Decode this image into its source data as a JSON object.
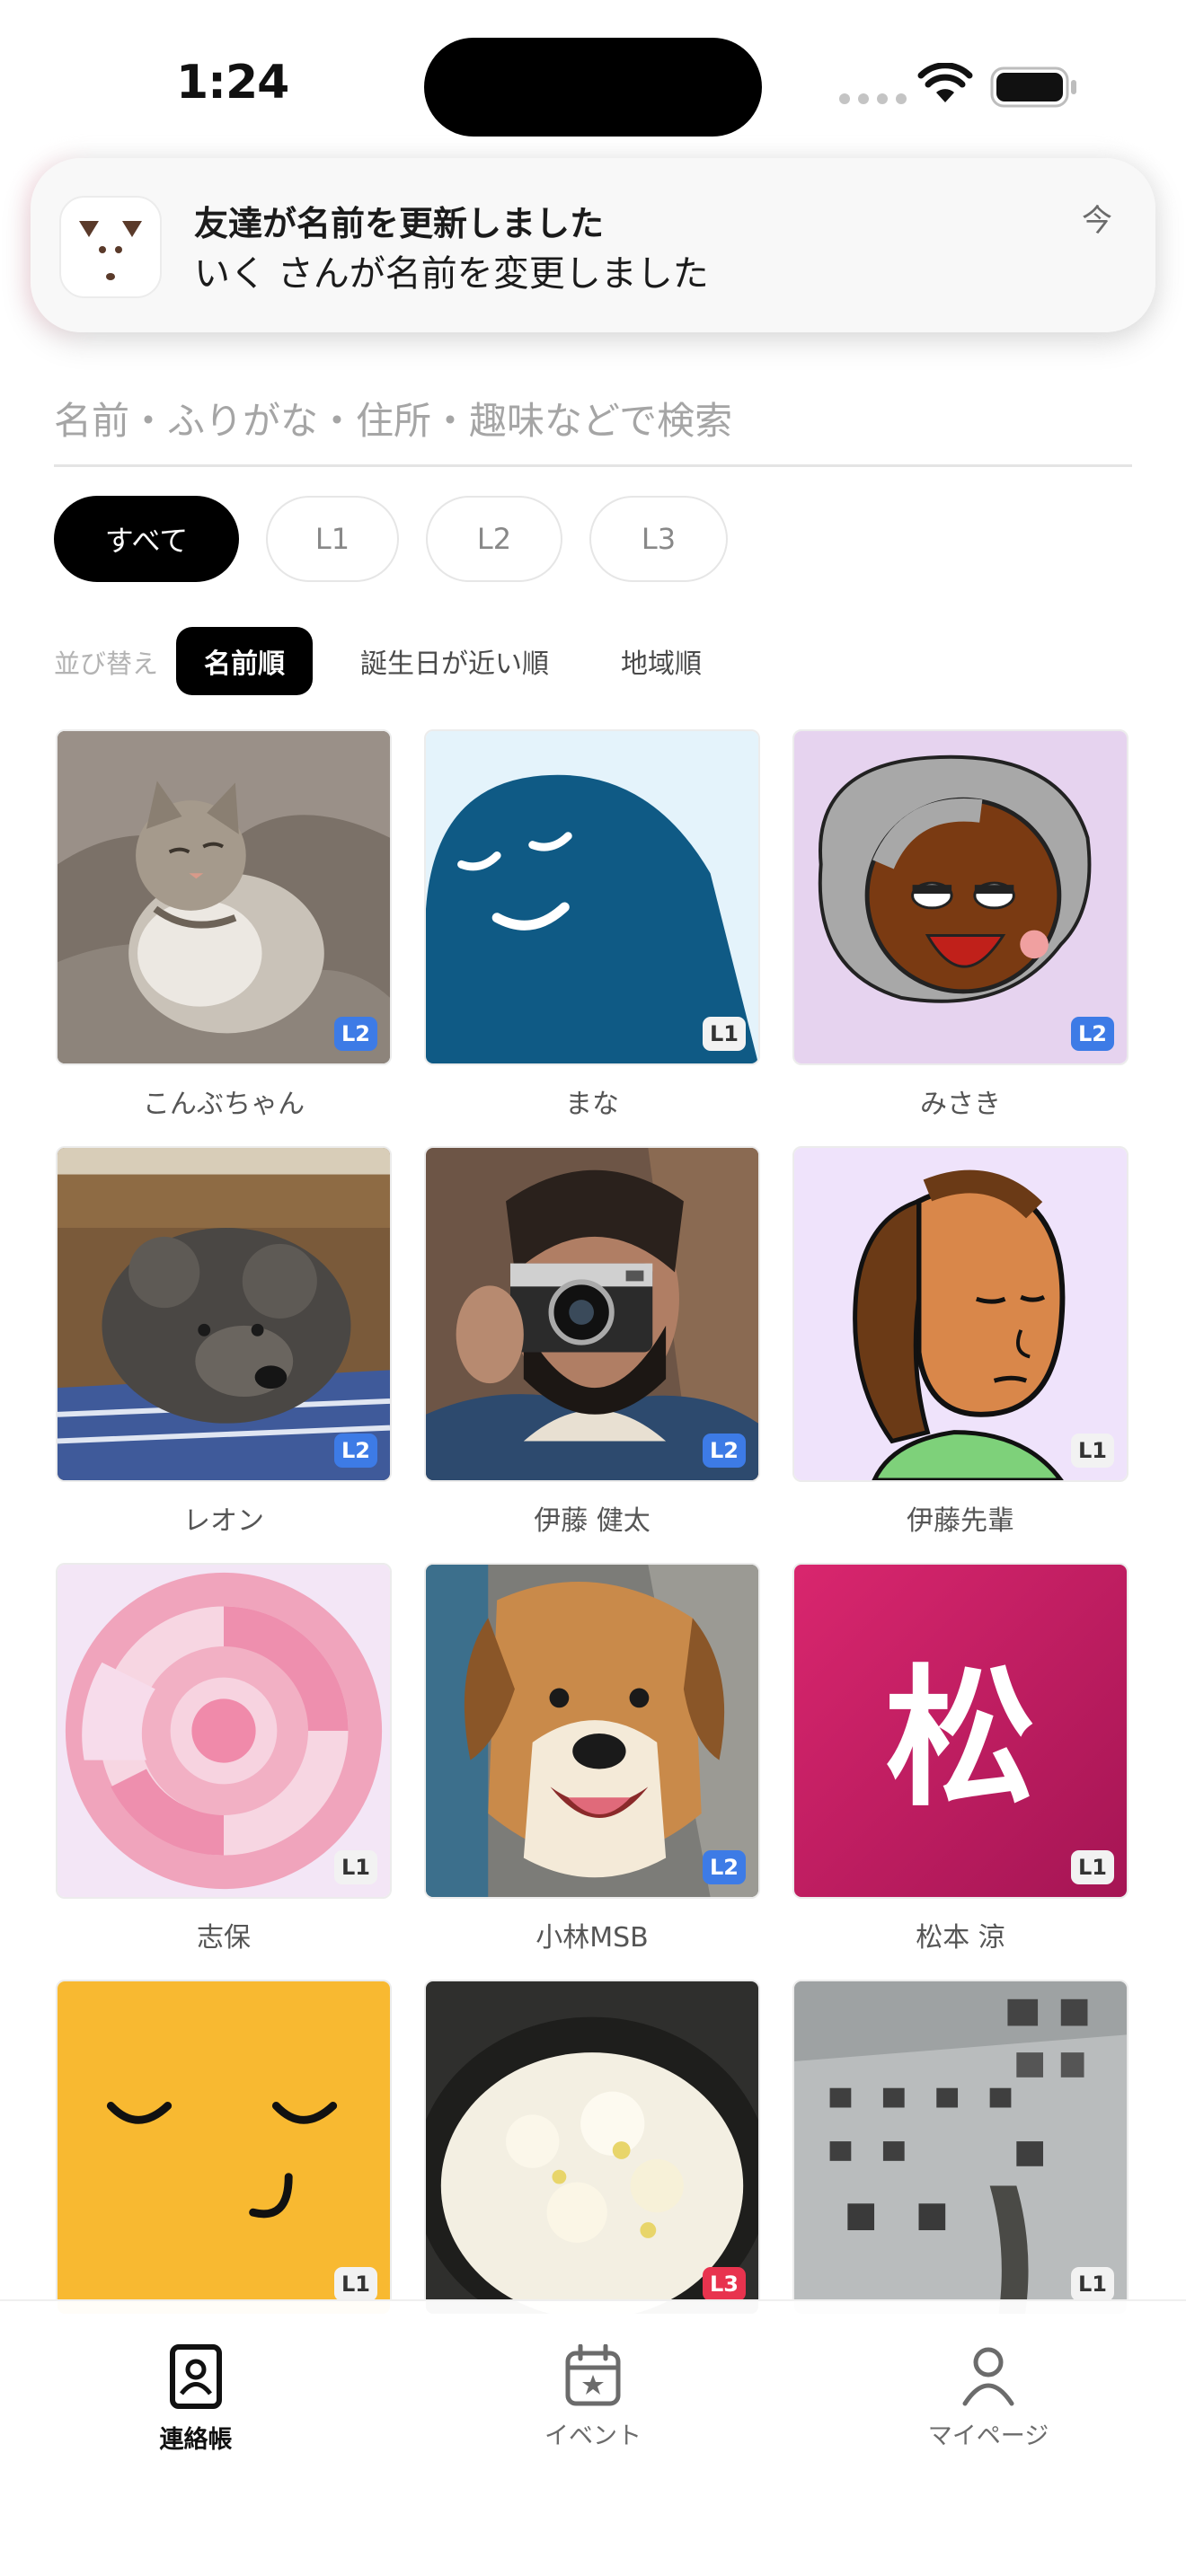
{
  "status_bar": {
    "time": "1:24"
  },
  "notification": {
    "title": "友達が名前を更新しました",
    "body": "いく さんが名前を変更しました",
    "time": "今"
  },
  "search": {
    "placeholder": "名前・ふりがな・住所・趣味などで検索",
    "value": ""
  },
  "filters": [
    {
      "label": "すべて",
      "active": true
    },
    {
      "label": "L1",
      "active": false
    },
    {
      "label": "L2",
      "active": false
    },
    {
      "label": "L3",
      "active": false
    }
  ],
  "sort": {
    "label": "並び替え",
    "options": [
      {
        "label": "名前順",
        "active": true
      },
      {
        "label": "誕生日が近い順",
        "active": false
      },
      {
        "label": "地域順",
        "active": false
      }
    ]
  },
  "contacts": [
    {
      "name": "こんぶちゃん",
      "level": "L2"
    },
    {
      "name": "まな",
      "level": "L1"
    },
    {
      "name": "みさき",
      "level": "L2"
    },
    {
      "name": "レオン",
      "level": "L2"
    },
    {
      "name": "伊藤 健太",
      "level": "L2"
    },
    {
      "name": "伊藤先輩",
      "level": "L1"
    },
    {
      "name": "志保",
      "level": "L1"
    },
    {
      "name": "小林MSB",
      "level": "L2"
    },
    {
      "name": "松本 涼",
      "level": "L1",
      "avatar_char": "松"
    },
    {
      "name": "",
      "level": "L1"
    },
    {
      "name": "",
      "level": "L3"
    },
    {
      "name": "",
      "level": "L1"
    }
  ],
  "tabs": [
    {
      "label": "連絡帳",
      "icon": "contacts-book-icon",
      "active": true
    },
    {
      "label": "イベント",
      "icon": "calendar-star-icon",
      "active": false
    },
    {
      "label": "マイページ",
      "icon": "person-icon",
      "active": false
    }
  ],
  "colors": {
    "l1_badge": "#f2f2f2",
    "l2_badge": "#3d7be6",
    "l3_badge": "#e8334e"
  }
}
